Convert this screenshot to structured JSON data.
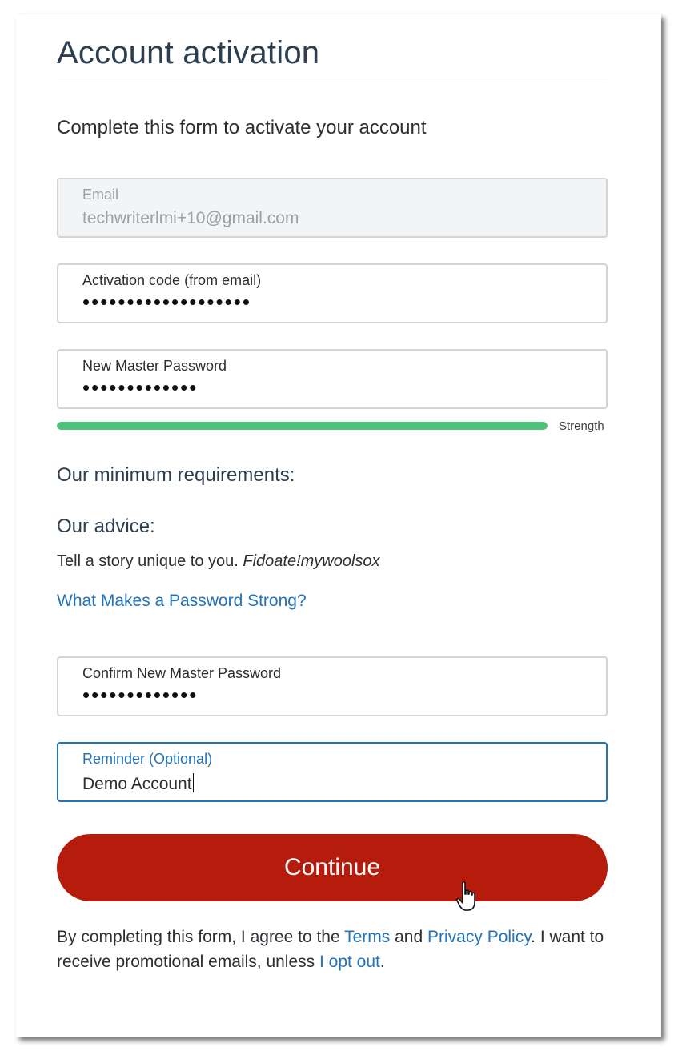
{
  "page": {
    "title": "Account activation",
    "subtitle": "Complete this form to activate your account"
  },
  "fields": {
    "email": {
      "label": "Email",
      "value": "techwriterlmi+10@gmail.com"
    },
    "activation_code": {
      "label": "Activation code (from email)",
      "masked_value": "•••••••••••••••••••"
    },
    "new_password": {
      "label": "New Master Password",
      "masked_value": "•••••••••••••"
    },
    "confirm_password": {
      "label": "Confirm New Master Password",
      "masked_value": "•••••••••••••"
    },
    "reminder": {
      "label": "Reminder (Optional)",
      "value": "Demo Account"
    }
  },
  "strength": {
    "label": "Strength",
    "level_fraction": 1.0,
    "color": "#4fc27a"
  },
  "requirements": {
    "heading": "Our minimum requirements:"
  },
  "advice": {
    "heading": "Our advice:",
    "text": "Tell a story unique to you.",
    "example": "Fidoate!mywoolsox",
    "link": "What Makes a Password Strong?"
  },
  "continue_button": {
    "label": "Continue",
    "color": "#b61c0c"
  },
  "legal": {
    "text_1": "By completing this form, I agree to the ",
    "terms_link": "Terms",
    "text_2": " and ",
    "privacy_link": "Privacy Policy",
    "text_3": ". I want to receive promotional emails, unless ",
    "opt_out_link": "I opt out",
    "text_4": "."
  },
  "colors": {
    "link": "#2273b8",
    "focus_border": "#2273b8",
    "title": "#2d3e50"
  },
  "icons": {
    "cursor": "hand-pointer-icon"
  }
}
